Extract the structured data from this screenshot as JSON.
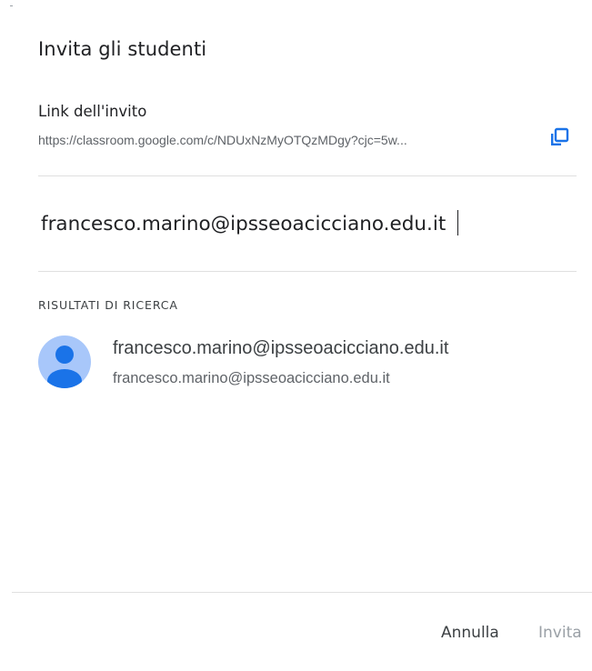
{
  "dialog": {
    "title": "Invita gli studenti"
  },
  "invite_link": {
    "label": "Link dell'invito",
    "url": "https://classroom.google.com/c/NDUxNzMyOTQzMDgy?cjc=5w...",
    "copy_icon": "copy-icon"
  },
  "search": {
    "value": "francesco.marino@ipsseoacicciano.edu.it"
  },
  "results": {
    "heading": "RISULTATI DI RICERCA",
    "items": [
      {
        "name": "francesco.marino@ipsseoacicciano.edu.it",
        "email": "francesco.marino@ipsseoacicciano.edu.it",
        "avatar_icon": "person-icon"
      }
    ]
  },
  "footer": {
    "cancel_label": "Annulla",
    "invite_label": "Invita"
  },
  "colors": {
    "accent": "#1a73e8",
    "avatar_bg": "#a8c7fa",
    "avatar_fg": "#1a73e8",
    "disabled_text": "#9aa0a6"
  }
}
